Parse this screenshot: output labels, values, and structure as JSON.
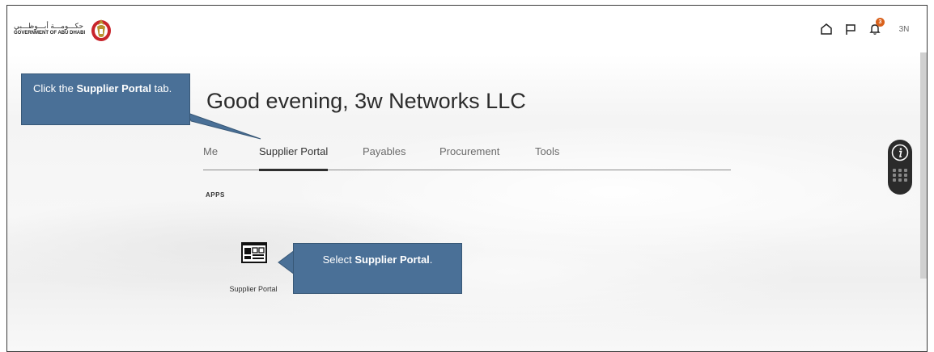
{
  "header": {
    "logo_arabic": "حكـــومـــة أبـــوظـــبي",
    "logo_english": "GOVERNMENT OF ABU DHABI",
    "notification_count": "3",
    "avatar_initials": "3N"
  },
  "main": {
    "greeting": "Good evening, 3w Networks LLC",
    "tabs": [
      {
        "label": "Me"
      },
      {
        "label": "Supplier Portal"
      },
      {
        "label": "Payables"
      },
      {
        "label": "Procurement"
      },
      {
        "label": "Tools"
      }
    ],
    "active_tab": "Supplier Portal",
    "apps_heading": "APPS",
    "apps": [
      {
        "label": "Supplier Portal",
        "icon": "supplier-portal-icon"
      }
    ]
  },
  "callouts": {
    "tab_prefix": "Click the ",
    "tab_bold": "Supplier Portal",
    "tab_suffix": " tab.",
    "app_prefix": "Select ",
    "app_bold": "Supplier Portal",
    "app_suffix": "."
  },
  "colors": {
    "callout_bg": "#4a7097",
    "notification_badge": "#d9611c"
  }
}
